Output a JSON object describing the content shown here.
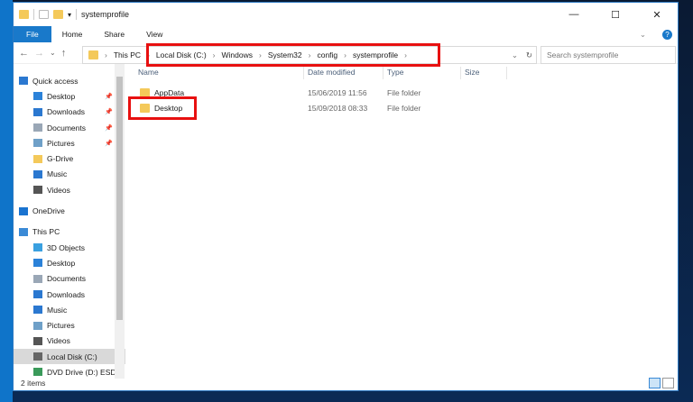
{
  "window": {
    "title": "systemprofile",
    "controls": {
      "min": "—",
      "max": "☐",
      "close": "✕"
    }
  },
  "ribbon": {
    "tabs": [
      "File",
      "Home",
      "Share",
      "View"
    ],
    "help": "?"
  },
  "address": {
    "segments": [
      "This PC",
      "Local Disk (C:)",
      "Windows",
      "System32",
      "config",
      "systemprofile"
    ],
    "search_placeholder": "Search systemprofile"
  },
  "sidebar": {
    "items": [
      {
        "label": "Quick access",
        "icon": "star-icon",
        "color": "#2b78d0",
        "indent": 0,
        "pin": false
      },
      {
        "label": "Desktop",
        "icon": "desktop-icon",
        "color": "#2b82d9",
        "indent": 1,
        "pin": true
      },
      {
        "label": "Downloads",
        "icon": "download-icon",
        "color": "#2b78d0",
        "indent": 1,
        "pin": true
      },
      {
        "label": "Documents",
        "icon": "documents-icon",
        "color": "#9aa7b6",
        "indent": 1,
        "pin": true
      },
      {
        "label": "Pictures",
        "icon": "pictures-icon",
        "color": "#6fa0c8",
        "indent": 1,
        "pin": true
      },
      {
        "label": "G-Drive",
        "icon": "folder-icon",
        "color": "#f4c95a",
        "indent": 1,
        "pin": false
      },
      {
        "label": "Music",
        "icon": "music-icon",
        "color": "#2b78d0",
        "indent": 1,
        "pin": false
      },
      {
        "label": "Videos",
        "icon": "videos-icon",
        "color": "#555",
        "indent": 1,
        "pin": false
      },
      {
        "label": "",
        "icon": "",
        "color": "",
        "indent": 0,
        "pin": false
      },
      {
        "label": "OneDrive",
        "icon": "cloud-icon",
        "color": "#1a73d0",
        "indent": 0,
        "pin": false
      },
      {
        "label": "",
        "icon": "",
        "color": "",
        "indent": 0,
        "pin": false
      },
      {
        "label": "This PC",
        "icon": "computer-icon",
        "color": "#3b8ad6",
        "indent": 0,
        "pin": false
      },
      {
        "label": "3D Objects",
        "icon": "cube-icon",
        "color": "#3aa0e0",
        "indent": 1,
        "pin": false
      },
      {
        "label": "Desktop",
        "icon": "desktop-icon",
        "color": "#2b82d9",
        "indent": 1,
        "pin": false
      },
      {
        "label": "Documents",
        "icon": "documents-icon",
        "color": "#9aa7b6",
        "indent": 1,
        "pin": false
      },
      {
        "label": "Downloads",
        "icon": "download-icon",
        "color": "#2b78d0",
        "indent": 1,
        "pin": false
      },
      {
        "label": "Music",
        "icon": "music-icon",
        "color": "#2b78d0",
        "indent": 1,
        "pin": false
      },
      {
        "label": "Pictures",
        "icon": "pictures-icon",
        "color": "#6fa0c8",
        "indent": 1,
        "pin": false
      },
      {
        "label": "Videos",
        "icon": "videos-icon",
        "color": "#555",
        "indent": 1,
        "pin": false
      },
      {
        "label": "Local Disk (C:)",
        "icon": "drive-icon",
        "color": "#666",
        "indent": 1,
        "pin": false,
        "selected": true
      },
      {
        "label": "DVD Drive (D:) ESD-",
        "icon": "dvd-icon",
        "color": "#3a9a5a",
        "indent": 1,
        "pin": false
      }
    ]
  },
  "columns": [
    "Name",
    "Date modified",
    "Type",
    "Size"
  ],
  "files": [
    {
      "name": "AppData",
      "date": "15/06/2019 11:56",
      "type": "File folder"
    },
    {
      "name": "Desktop",
      "date": "15/09/2018 08:33",
      "type": "File folder"
    }
  ],
  "status": {
    "count": "2 items"
  }
}
